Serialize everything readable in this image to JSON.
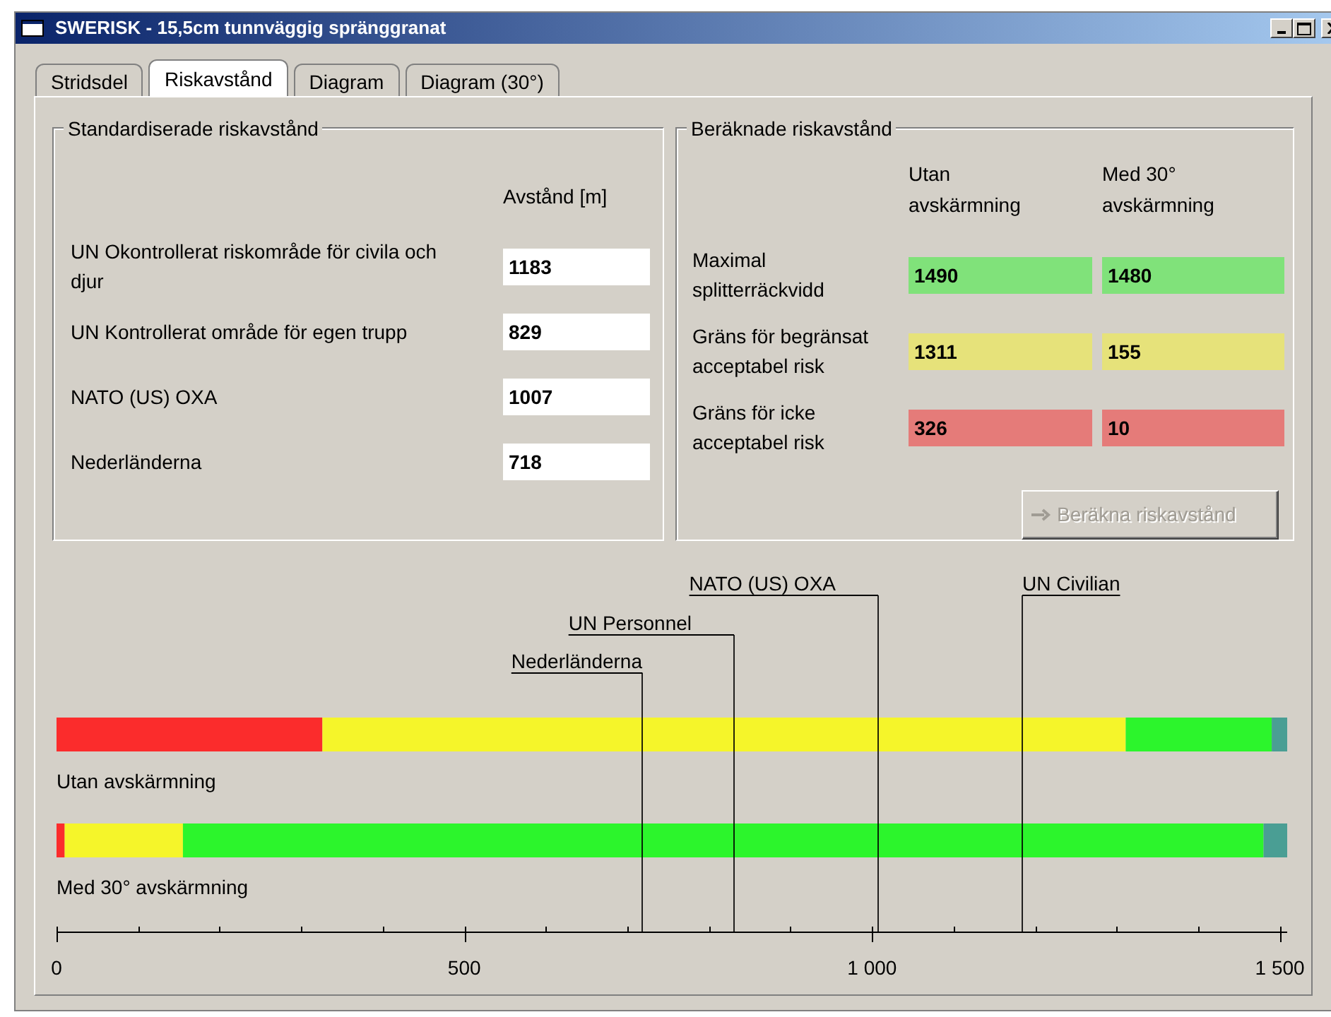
{
  "window": {
    "title": "SWERISK - 15,5cm tunnväggig spränggranat"
  },
  "tabs": [
    {
      "label": "Stridsdel",
      "selected": false
    },
    {
      "label": "Riskavstånd",
      "selected": true
    },
    {
      "label": "Diagram",
      "selected": false
    },
    {
      "label": "Diagram (30°)",
      "selected": false
    }
  ],
  "standard_group": {
    "title": "Standardiserade riskavstånd",
    "column_header": "Avstånd [m]",
    "rows": [
      {
        "label": "UN Okontrollerat riskområde för civila och djur",
        "value": "1183"
      },
      {
        "label": "UN Kontrollerat område för egen trupp",
        "value": "829"
      },
      {
        "label": "NATO (US) OXA",
        "value": "1007"
      },
      {
        "label": "Nederländerna",
        "value": "718"
      }
    ]
  },
  "computed_group": {
    "title": "Beräknade riskavstånd",
    "columns": [
      "Utan avskärmning",
      "Med 30° avskärmning"
    ],
    "rows": [
      {
        "label": "Maximal splitterräckvidd",
        "values": [
          {
            "text": "1490",
            "color": "#80e27a"
          },
          {
            "text": "1480",
            "color": "#80e27a"
          }
        ]
      },
      {
        "label": "Gräns för begränsat acceptabel risk",
        "values": [
          {
            "text": "1311",
            "color": "#e6e27a"
          },
          {
            "text": "155",
            "color": "#e6e27a"
          }
        ]
      },
      {
        "label": "Gräns för icke acceptabel risk",
        "values": [
          {
            "text": "326",
            "color": "#e57b79"
          },
          {
            "text": "10",
            "color": "#e57b79"
          }
        ]
      }
    ],
    "button": {
      "label": "Beräkna riskavstånd",
      "disabled": true
    }
  },
  "chart": {
    "chart_data": {
      "type": "bar",
      "orientation": "horizontal",
      "stacked": true,
      "categories": [
        "Utan avskärmning",
        "Med 30° avskärmning"
      ],
      "series": [
        {
          "color": "#fb2c2c",
          "values": [
            326,
            10
          ]
        },
        {
          "color": "#f5f52a",
          "values": [
            985,
            145
          ]
        },
        {
          "color": "#2cf52c",
          "values": [
            179,
            1325
          ]
        },
        {
          "color": "#4a9e94",
          "values": [
            19,
            29
          ]
        }
      ],
      "xlim": [
        0,
        1509
      ],
      "xticks": [
        0,
        500,
        {
          "value": 1000,
          "label": "1 000"
        },
        {
          "value": 1500,
          "label": "1 500"
        }
      ],
      "ref_lines": [
        {
          "axis": "x",
          "value": 718,
          "label": "Nederländerna"
        },
        {
          "axis": "x",
          "value": 829,
          "label": "UN Personnel"
        },
        {
          "axis": "x",
          "value": 1007,
          "label": "NATO (US) OXA"
        },
        {
          "axis": "x",
          "value": 1183,
          "label": "UN Civilian"
        }
      ]
    }
  }
}
